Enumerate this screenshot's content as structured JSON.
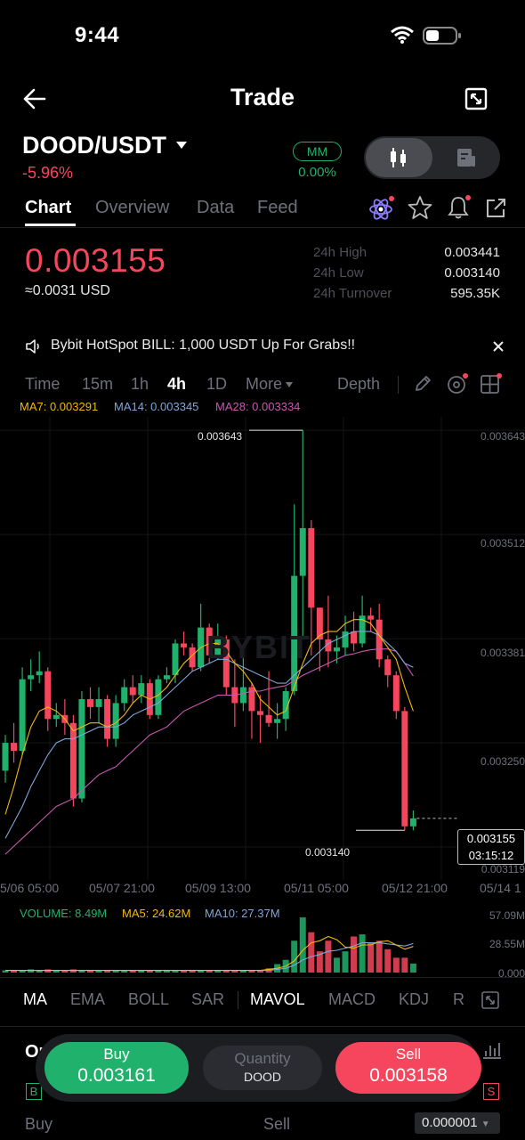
{
  "status_bar": {
    "time": "9:44"
  },
  "header": {
    "title": "Trade"
  },
  "pair": {
    "symbol": "DOOD/USDT",
    "change": "-5.96%",
    "mm_label": "MM",
    "mm_value": "0.00%"
  },
  "tabs": [
    {
      "label": "Chart",
      "active": true
    },
    {
      "label": "Overview"
    },
    {
      "label": "Data"
    },
    {
      "label": "Feed"
    }
  ],
  "ticker": {
    "last_price": "0.003155",
    "usd_price": "≈0.0031 USD",
    "high_label": "24h High",
    "high_value": "0.003441",
    "low_label": "24h Low",
    "low_value": "0.003140",
    "turnover_label": "24h Turnover",
    "turnover_value": "595.35K"
  },
  "announcement": "Bybit HotSpot BILL: 1,000 USDT Up For Grabs!!",
  "timeframes": {
    "time": "Time",
    "m15": "15m",
    "h1": "1h",
    "h4": "4h",
    "d1": "1D",
    "more": "More",
    "depth": "Depth",
    "active": "4h"
  },
  "ma_legend": {
    "ma7": "MA7: 0.003291",
    "ma14": "MA14: 0.003345",
    "ma28": "MA28: 0.003334"
  },
  "colors": {
    "up": "#20b26c",
    "down": "#f6465d",
    "ma7": "#f0b90b",
    "ma14": "#7fa6d8",
    "ma28": "#c659b0"
  },
  "chart": {
    "watermark": "BYBIT",
    "y_labels": [
      "0.003643",
      "0.003512",
      "0.003381",
      "0.003250",
      "0.003119"
    ],
    "x_labels": [
      "5/06 05:00",
      "05/07 21:00",
      "05/09 13:00",
      "05/11 05:00",
      "05/12 21:00",
      "05/14 1"
    ],
    "high_marker": "0.003643",
    "low_marker": "0.003140",
    "current_price": "0.003155",
    "countdown": "03:15:12"
  },
  "volume": {
    "legend_volume": "VOLUME: 8.49M",
    "legend_ma5": "MA5: 24.62M",
    "legend_ma10": "MA10: 27.37M",
    "y_labels": [
      "57.09M",
      "28.55M",
      "0.000"
    ]
  },
  "indicators": {
    "ma": "MA",
    "ema": "EMA",
    "boll": "BOLL",
    "sar": "SAR",
    "mavol": "MAVOL",
    "macd": "MACD",
    "kdj": "KDJ",
    "r": "R"
  },
  "order_book": {
    "title": "Or",
    "b_badge": "B",
    "s_badge": "S",
    "buy_col": "Buy",
    "sell_col": "Sell",
    "tick_size": "0.000001"
  },
  "trade_bar": {
    "buy_label": "Buy",
    "buy_price": "0.003161",
    "qty_label": "Quantity",
    "qty_unit": "DOOD",
    "sell_label": "Sell",
    "sell_price": "0.003158"
  },
  "chart_data": {
    "type": "candlestick",
    "y_range": [
      0.0031,
      0.00366
    ],
    "candles": [
      [
        0.003215,
        0.00325,
        0.0032,
        0.00326
      ],
      [
        0.00325,
        0.00324,
        0.003225,
        0.003275
      ],
      [
        0.00324,
        0.00333,
        0.003235,
        0.003345
      ],
      [
        0.00333,
        0.003335,
        0.003315,
        0.003355
      ],
      [
        0.003335,
        0.00334,
        0.003325,
        0.003365
      ],
      [
        0.00334,
        0.00328,
        0.003265,
        0.003345
      ],
      [
        0.00328,
        0.003285,
        0.00327,
        0.0033
      ],
      [
        0.003285,
        0.003275,
        0.00326,
        0.003305
      ],
      [
        0.003275,
        0.00318,
        0.00317,
        0.003285
      ],
      [
        0.00318,
        0.003305,
        0.003175,
        0.003315
      ],
      [
        0.003305,
        0.003295,
        0.00328,
        0.00332
      ],
      [
        0.003295,
        0.003305,
        0.003275,
        0.00332
      ],
      [
        0.003305,
        0.003255,
        0.003245,
        0.00331
      ],
      [
        0.003255,
        0.0033,
        0.003245,
        0.00331
      ],
      [
        0.0033,
        0.00332,
        0.00329,
        0.00333
      ],
      [
        0.00332,
        0.00331,
        0.0033,
        0.003335
      ],
      [
        0.00331,
        0.003325,
        0.0033,
        0.003335
      ],
      [
        0.003325,
        0.003285,
        0.00328,
        0.00333
      ],
      [
        0.003285,
        0.00333,
        0.00328,
        0.003335
      ],
      [
        0.00333,
        0.003335,
        0.003325,
        0.003345
      ],
      [
        0.003335,
        0.003375,
        0.003325,
        0.00338
      ],
      [
        0.003375,
        0.00337,
        0.00336,
        0.00339
      ],
      [
        0.00337,
        0.003345,
        0.00334,
        0.003375
      ],
      [
        0.003345,
        0.003395,
        0.00334,
        0.003425
      ],
      [
        0.003395,
        0.00336,
        0.00335,
        0.0034
      ],
      [
        0.00336,
        0.00338,
        0.003355,
        0.0034
      ],
      [
        0.00338,
        0.00332,
        0.00331,
        0.003385
      ],
      [
        0.00332,
        0.0033,
        0.00327,
        0.003355
      ],
      [
        0.0033,
        0.00332,
        0.00329,
        0.00336
      ],
      [
        0.00332,
        0.00329,
        0.003255,
        0.003325
      ],
      [
        0.00329,
        0.003285,
        0.00325,
        0.00331
      ],
      [
        0.003285,
        0.003275,
        0.00327,
        0.00334
      ],
      [
        0.003275,
        0.00328,
        0.003255,
        0.0033
      ],
      [
        0.00328,
        0.003315,
        0.003265,
        0.00332
      ],
      [
        0.003315,
        0.00346,
        0.00331,
        0.00355
      ],
      [
        0.00346,
        0.00352,
        0.00338,
        0.003643
      ],
      [
        0.00352,
        0.00342,
        0.00336,
        0.00353
      ],
      [
        0.00342,
        0.00338,
        0.00334,
        0.00342
      ],
      [
        0.00338,
        0.003365,
        0.003345,
        0.003435
      ],
      [
        0.003365,
        0.00337,
        0.00335,
        0.003385
      ],
      [
        0.00337,
        0.00339,
        0.00336,
        0.00341
      ],
      [
        0.00339,
        0.003375,
        0.003365,
        0.003415
      ],
      [
        0.003375,
        0.00341,
        0.00337,
        0.003435
      ],
      [
        0.00341,
        0.003405,
        0.00339,
        0.00342
      ],
      [
        0.003405,
        0.003355,
        0.003345,
        0.003425
      ],
      [
        0.003355,
        0.003335,
        0.00332,
        0.00336
      ],
      [
        0.003335,
        0.00329,
        0.00328,
        0.00334
      ],
      [
        0.00329,
        0.003145,
        0.00314,
        0.003295
      ],
      [
        0.003145,
        0.003155,
        0.00314,
        0.003165
      ]
    ],
    "ma7": [
      0.00316,
      0.003195,
      0.003235,
      0.00327,
      0.00329,
      0.003295,
      0.00329,
      0.00328,
      0.003265,
      0.00327,
      0.003275,
      0.003275,
      0.00327,
      0.003275,
      0.003285,
      0.0033,
      0.00331,
      0.003305,
      0.00331,
      0.00332,
      0.003335,
      0.00335,
      0.00336,
      0.00337,
      0.003375,
      0.003375,
      0.003365,
      0.00335,
      0.00334,
      0.003325,
      0.003305,
      0.003295,
      0.003285,
      0.00329,
      0.00332,
      0.00335,
      0.003375,
      0.003385,
      0.00339,
      0.00339,
      0.0034,
      0.003405,
      0.003405,
      0.0034,
      0.003385,
      0.00337,
      0.003355,
      0.00332,
      0.00329
    ],
    "ma14": [
      0.00313,
      0.00315,
      0.00317,
      0.003195,
      0.003215,
      0.003235,
      0.00325,
      0.003255,
      0.003255,
      0.00326,
      0.003265,
      0.00327,
      0.00327,
      0.00327,
      0.003275,
      0.003285,
      0.00329,
      0.003295,
      0.0033,
      0.00331,
      0.00332,
      0.00333,
      0.00334,
      0.003345,
      0.00335,
      0.003355,
      0.003355,
      0.00335,
      0.003345,
      0.00334,
      0.003335,
      0.00333,
      0.003325,
      0.003325,
      0.003335,
      0.003345,
      0.003355,
      0.003365,
      0.003375,
      0.00338,
      0.003385,
      0.00339,
      0.00339,
      0.00339,
      0.003385,
      0.003375,
      0.003365,
      0.00335,
      0.003345
    ],
    "ma28": [
      0.00311,
      0.00312,
      0.00313,
      0.00314,
      0.00315,
      0.00316,
      0.00317,
      0.003175,
      0.00318,
      0.00319,
      0.0032,
      0.00321,
      0.003215,
      0.00322,
      0.00323,
      0.00324,
      0.00325,
      0.00326,
      0.003265,
      0.00327,
      0.00328,
      0.00329,
      0.003295,
      0.0033,
      0.003305,
      0.00331,
      0.00331,
      0.00331,
      0.003312,
      0.003315,
      0.003315,
      0.003318,
      0.00332,
      0.003322,
      0.003328,
      0.003335,
      0.00334,
      0.003345,
      0.00335,
      0.003355,
      0.00336,
      0.003362,
      0.003365,
      0.003367,
      0.003368,
      0.003368,
      0.003365,
      0.00335,
      0.003334
    ],
    "volume_range": [
      0,
      57.09
    ],
    "volumes": [
      2,
      2,
      2,
      3,
      2,
      3,
      2,
      2,
      3,
      2,
      2,
      2,
      2,
      2,
      2,
      2,
      2,
      2,
      2,
      2,
      2,
      2,
      2,
      2,
      2,
      2,
      2,
      2,
      2,
      2,
      2,
      4,
      8,
      12,
      30,
      52,
      38,
      20,
      30,
      14,
      20,
      34,
      36,
      28,
      30,
      22,
      14,
      14,
      8.49
    ],
    "vol_ma5": [
      2,
      2,
      2,
      2,
      2,
      2,
      2,
      2,
      2,
      2,
      2,
      2,
      2,
      2,
      2,
      2,
      2,
      2,
      2,
      2,
      2,
      2,
      2,
      2,
      2,
      2,
      2,
      2,
      2,
      2,
      2,
      3,
      4,
      6,
      11,
      21,
      28,
      30,
      34,
      31,
      24,
      23,
      26,
      26,
      29,
      30,
      26,
      22,
      24.62
    ],
    "vol_ma10": [
      2,
      2,
      2,
      2,
      2,
      2,
      2,
      2,
      2,
      2,
      2,
      2,
      2,
      2,
      2,
      2,
      2,
      2,
      2,
      2,
      2,
      2,
      2,
      2,
      2,
      2,
      2,
      2,
      2,
      2,
      2,
      2,
      3,
      4,
      7,
      12,
      15,
      17,
      20,
      21,
      23,
      25,
      28,
      28,
      28,
      27,
      26,
      25,
      27.37
    ]
  }
}
